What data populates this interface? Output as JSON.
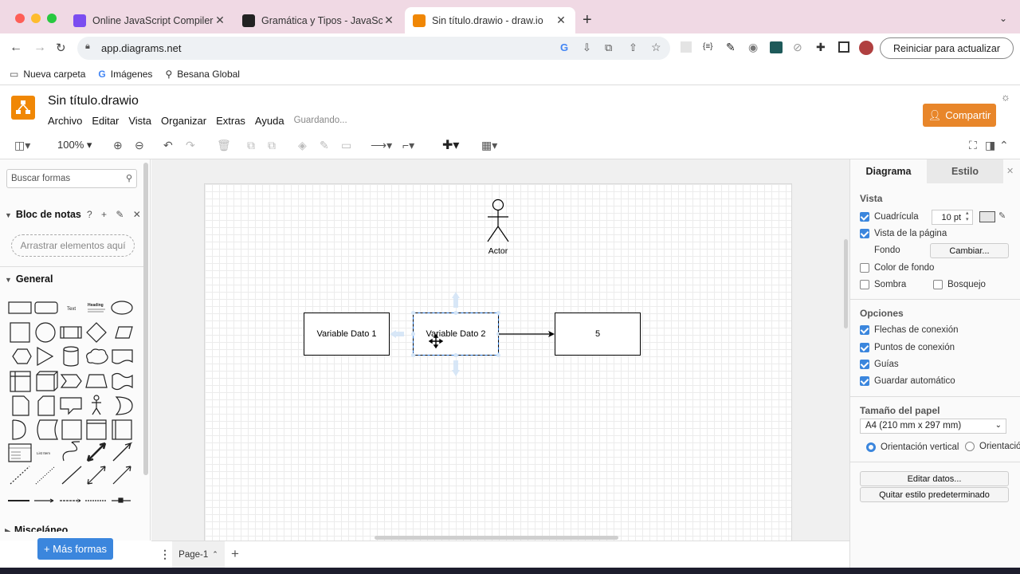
{
  "browser": {
    "tabs": [
      {
        "title": "Online JavaScript Compiler (E",
        "color": "#7b4df0"
      },
      {
        "title": "Gramática y Tipos - JavaScrip",
        "color": "#222222"
      },
      {
        "title": "Sin título.drawio - draw.io",
        "color": "#f08705"
      }
    ],
    "new_tab": "+",
    "url": "app.diagrams.net",
    "update_button": "Reiniciar para actualizar",
    "bookmarks": [
      {
        "label": "Nueva carpeta",
        "icon": "folder-icon"
      },
      {
        "label": "Imágenes",
        "icon": "google-icon"
      },
      {
        "label": "Besana Global",
        "icon": "rocket-icon"
      }
    ]
  },
  "app": {
    "doc_title": "Sin título.drawio",
    "menus": [
      "Archivo",
      "Editar",
      "Vista",
      "Organizar",
      "Extras",
      "Ayuda"
    ],
    "status": "Guardando...",
    "share_button": "Compartir",
    "zoom": "100%"
  },
  "left_panel": {
    "search_placeholder": "Buscar formas",
    "scratchpad_title": "Bloc de notas",
    "scratchpad_icons": "? + ✎ ✕",
    "drop_hint": "Arrastrar elementos aquí",
    "general_title": "General",
    "misc_title": "Misceláneo",
    "shape_text": "Text",
    "shape_heading": "Heading",
    "shape_list": "List Item",
    "more_shapes": "+ Más formas"
  },
  "diagram": {
    "actor_label": "Actor",
    "box1": "Variable Dato 1",
    "box2": "Variable Dato 2",
    "box3": "5"
  },
  "page_tabs": {
    "current": "Page-1"
  },
  "right_panel": {
    "tab_diagram": "Diagrama",
    "tab_style": "Estilo",
    "view_title": "Vista",
    "grid": "Cuadrícula",
    "grid_size": "10 pt",
    "page_view": "Vista de la página",
    "background": "Fondo",
    "change_button": "Cambiar...",
    "bg_color": "Color de fondo",
    "shadow": "Sombra",
    "sketch": "Bosquejo",
    "options_title": "Opciones",
    "conn_arrows": "Flechas de conexión",
    "conn_points": "Puntos de conexión",
    "guides": "Guías",
    "autosave": "Guardar automático",
    "paper_title": "Tamaño del papel",
    "paper_size": "A4 (210 mm x 297 mm)",
    "portrait": "Orientación vertical",
    "landscape": "Orientación",
    "edit_data": "Editar datos...",
    "remove_style": "Quitar estilo predeterminado"
  }
}
